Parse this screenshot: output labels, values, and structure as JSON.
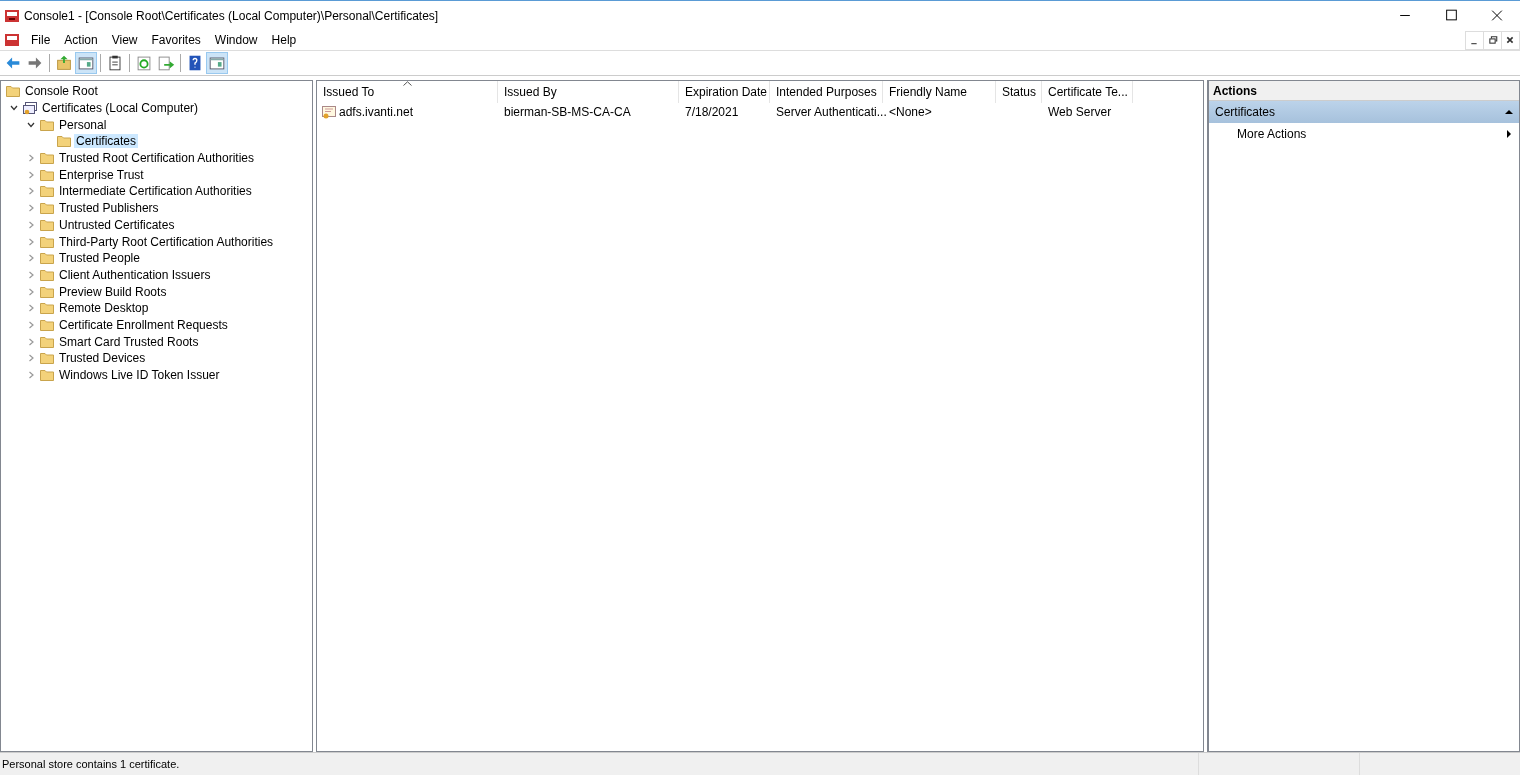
{
  "window": {
    "title": "Console1 - [Console Root\\Certificates (Local Computer)\\Personal\\Certificates]"
  },
  "menu": [
    "File",
    "Action",
    "View",
    "Favorites",
    "Window",
    "Help"
  ],
  "toolbar": [
    {
      "kind": "back",
      "pressed": false
    },
    {
      "kind": "forward",
      "pressed": false
    },
    {
      "kind": "separator"
    },
    {
      "kind": "up",
      "pressed": false
    },
    {
      "kind": "tree-toggle",
      "pressed": true
    },
    {
      "kind": "separator"
    },
    {
      "kind": "clipboard",
      "pressed": false
    },
    {
      "kind": "separator"
    },
    {
      "kind": "refresh",
      "pressed": false
    },
    {
      "kind": "export",
      "pressed": false
    },
    {
      "kind": "separator"
    },
    {
      "kind": "help",
      "pressed": false
    },
    {
      "kind": "pane-toggle",
      "pressed": true
    }
  ],
  "tree": [
    {
      "label": "Console Root",
      "kind": "folder",
      "selected": false,
      "children": [
        {
          "label": "Certificates (Local Computer)",
          "kind": "store",
          "expanded": true,
          "selected": false,
          "children": [
            {
              "label": "Personal",
              "kind": "folder",
              "expanded": true,
              "selected": false,
              "children": [
                {
                  "label": "Certificates",
                  "kind": "folder",
                  "selected": true
                }
              ]
            },
            {
              "label": "Trusted Root Certification Authorities",
              "kind": "folder",
              "expanded": false,
              "selected": false
            },
            {
              "label": "Enterprise Trust",
              "kind": "folder",
              "expanded": false,
              "selected": false
            },
            {
              "label": "Intermediate Certification Authorities",
              "kind": "folder",
              "expanded": false,
              "selected": false
            },
            {
              "label": "Trusted Publishers",
              "kind": "folder",
              "expanded": false,
              "selected": false
            },
            {
              "label": "Untrusted Certificates",
              "kind": "folder",
              "expanded": false,
              "selected": false
            },
            {
              "label": "Third-Party Root Certification Authorities",
              "kind": "folder",
              "expanded": false,
              "selected": false
            },
            {
              "label": "Trusted People",
              "kind": "folder",
              "expanded": false,
              "selected": false
            },
            {
              "label": "Client Authentication Issuers",
              "kind": "folder",
              "expanded": false,
              "selected": false
            },
            {
              "label": "Preview Build Roots",
              "kind": "folder",
              "expanded": false,
              "selected": false
            },
            {
              "label": "Remote Desktop",
              "kind": "folder",
              "expanded": false,
              "selected": false
            },
            {
              "label": "Certificate Enrollment Requests",
              "kind": "folder",
              "expanded": false,
              "selected": false
            },
            {
              "label": "Smart Card Trusted Roots",
              "kind": "folder",
              "expanded": false,
              "selected": false
            },
            {
              "label": "Trusted Devices",
              "kind": "folder",
              "expanded": false,
              "selected": false
            },
            {
              "label": "Windows Live ID Token Issuer",
              "kind": "folder",
              "expanded": false,
              "selected": false
            }
          ]
        }
      ]
    }
  ],
  "table": {
    "columns": [
      {
        "label": "Issued To",
        "sorted": true
      },
      {
        "label": "Issued By",
        "sorted": false
      },
      {
        "label": "Expiration Date",
        "sorted": false
      },
      {
        "label": "Intended Purposes",
        "sorted": false
      },
      {
        "label": "Friendly Name",
        "sorted": false
      },
      {
        "label": "Status",
        "sorted": false
      },
      {
        "label": "Certificate Te...",
        "sorted": false
      }
    ],
    "rows": [
      {
        "cells": [
          "adfs.ivanti.net",
          "bierman-SB-MS-CA-CA",
          "7/18/2021",
          "Server Authenticati...",
          "<None>",
          "",
          "Web Server"
        ],
        "selected": false
      }
    ]
  },
  "actions": {
    "title": "Actions",
    "sections": [
      {
        "label": "Certificates",
        "expanded": true,
        "items": [
          "More Actions"
        ]
      }
    ]
  },
  "status_bar": "Personal store contains 1 certificate."
}
